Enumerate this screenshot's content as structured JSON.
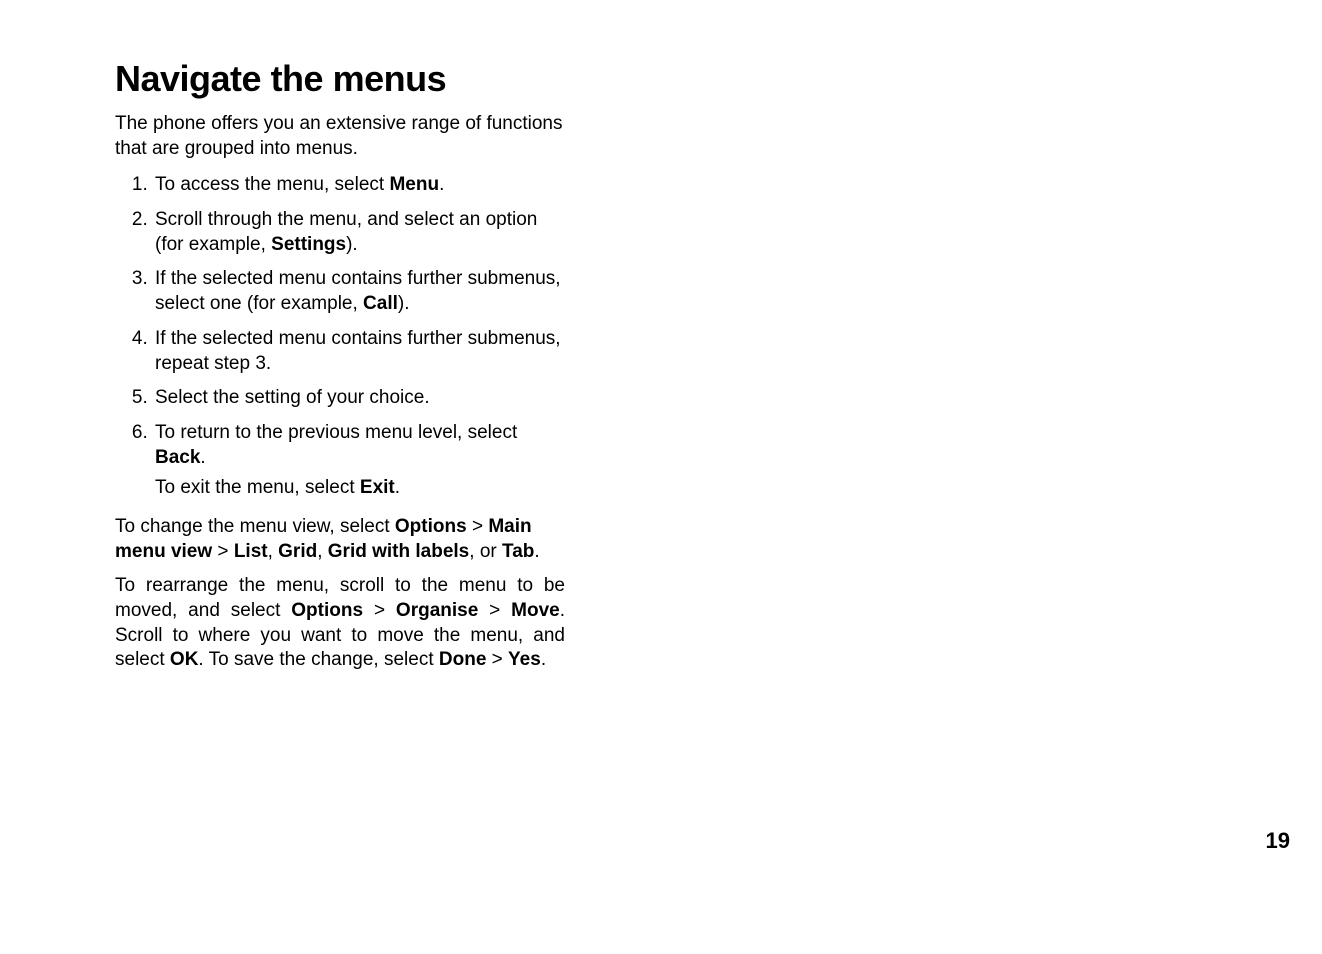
{
  "title": "Navigate the menus",
  "intro": "The phone offers you an extensive range of functions that are grouped into menus.",
  "steps": {
    "s1_a": "To access the menu, select ",
    "s1_b": "Menu",
    "s1_c": ".",
    "s2_a": "Scroll through the menu, and select an option (for example, ",
    "s2_b": "Settings",
    "s2_c": ").",
    "s3_a": "If the selected menu contains further submenus, select one (for example, ",
    "s3_b": "Call",
    "s3_c": ").",
    "s4": "If the selected menu contains further submenus, repeat step 3.",
    "s5": "Select the setting of your choice.",
    "s6_a": "To return to the previous menu level, select ",
    "s6_b": "Back",
    "s6_c": ".",
    "s6_sub_a": "To exit the menu, select ",
    "s6_sub_b": "Exit",
    "s6_sub_c": "."
  },
  "p1": {
    "t1": "To change the menu view, select ",
    "b1": "Options",
    "gt1": "  >  ",
    "b2": "Main menu view",
    "gt2": "  >  ",
    "b3": "List",
    "t2": ", ",
    "b4": "Grid",
    "t3": ", ",
    "b5": "Grid with labels",
    "t4": ", or ",
    "b6": "Tab",
    "t5": "."
  },
  "p2": {
    "t1": "To rearrange the menu, scroll to the menu to be moved, and select ",
    "b1": "Options",
    "gt1": "  >  ",
    "b2": "Organise",
    "gt2": "  >  ",
    "b3": "Move",
    "t2": ". Scroll to where you want to move the menu, and select ",
    "b4": "OK",
    "t3": ". To save the change, select ",
    "b5": "Done",
    "gt3": "  >  ",
    "b6": "Yes",
    "t4": "."
  },
  "page_number": "19"
}
